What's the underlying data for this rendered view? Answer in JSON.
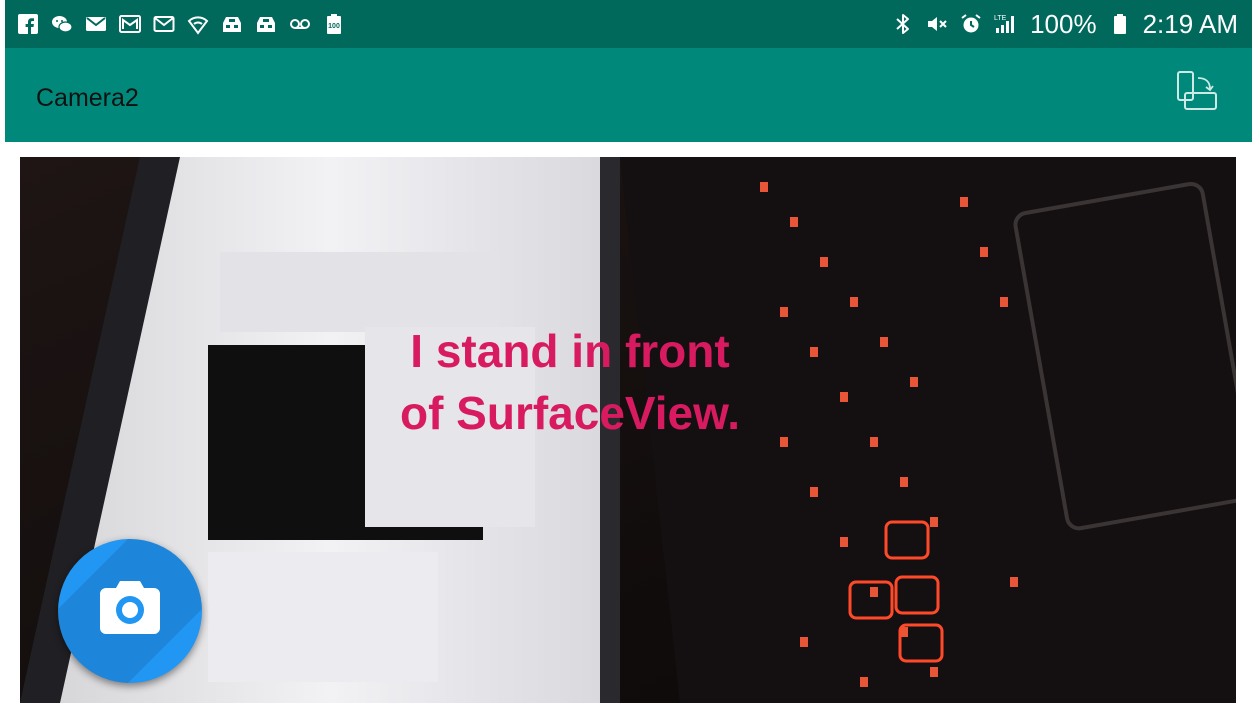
{
  "status_bar": {
    "background": "#00695c",
    "left_icons": [
      "facebook-icon",
      "wechat-icon",
      "email-icon",
      "gmail-icon",
      "email-outline-icon",
      "wifi-shield-icon",
      "game-icon",
      "game-icon",
      "voicemail-icon",
      "battery-100-icon"
    ],
    "mini_battery_label": "100",
    "right_icons": [
      "bluetooth-icon",
      "mute-icon",
      "alarm-icon",
      "lte-signal-icon"
    ],
    "network_label": "LTE",
    "battery": "100%",
    "time": "2:19 AM"
  },
  "toolbar": {
    "background": "#00897b",
    "title": "Camera2",
    "action_icon": "screen-rotation-icon"
  },
  "preview": {
    "overlay_text_line1": "I stand in front",
    "overlay_text_line2": "of SurfaceView.",
    "overlay_color": "#d81b60"
  },
  "fab": {
    "icon": "camera-icon",
    "color": "#2196f3"
  }
}
